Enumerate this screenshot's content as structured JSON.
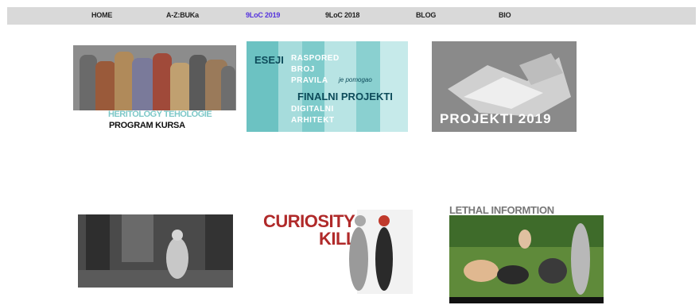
{
  "nav": {
    "items": [
      {
        "label": "HOME"
      },
      {
        "label": "A-Z:BUKa"
      },
      {
        "label": "9LoC 2019",
        "active": true
      },
      {
        "label": "9LoC 2018"
      },
      {
        "label": "BLOG"
      },
      {
        "label": "BIO"
      }
    ]
  },
  "tiles": {
    "t1": {
      "line1": "HERITOLOGY TEHOLOGIE",
      "line2": "PROGRAM KURSA"
    },
    "t2": {
      "esej": "ESEJI",
      "w1": "RASPORED",
      "w2": "BROJ",
      "w3": "PRAVILA",
      "w4": "je pomogao",
      "finalni": "FINALNI PROJEKTI",
      "w5": "DIGITALNI",
      "w6": "ARHITEKT"
    },
    "t3": {
      "caption": "PROJEKTI 2019"
    },
    "t5": {
      "line1": "CURIOSITY",
      "line2": "KILLS"
    },
    "t6": {
      "caption": "LETHAL INFORMTION"
    }
  },
  "colors": {
    "nav_bg": "#d9d9d9",
    "nav_active": "#5533dd",
    "teal": "#8fd2d2",
    "curiosity_red": "#b02a2a"
  }
}
